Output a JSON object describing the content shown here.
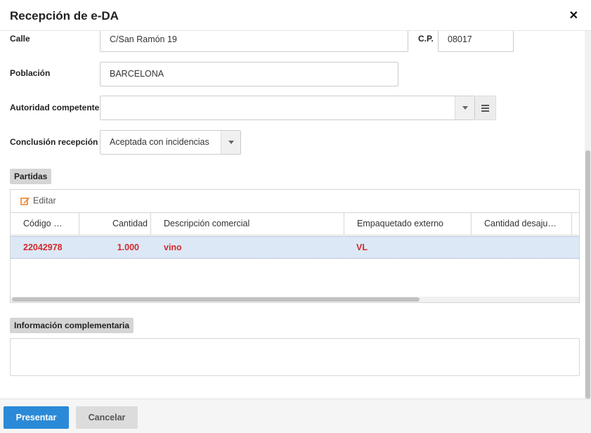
{
  "dialog": {
    "title": "Recepción de e-DA",
    "close_icon": "close-icon"
  },
  "form": {
    "calle": {
      "label": "Calle",
      "value": "C/San Ramón 19"
    },
    "cp": {
      "label": "C.P.",
      "value": "08017"
    },
    "poblacion": {
      "label": "Población",
      "value": "BARCELONA"
    },
    "autoridad": {
      "label": "Autoridad competente",
      "value": ""
    },
    "conclusion": {
      "label": "Conclusión recepción",
      "value": "Aceptada con incidencias"
    }
  },
  "partidas": {
    "section_label": "Partidas",
    "toolbar": {
      "edit_label": "Editar",
      "edit_icon": "pencil-icon"
    },
    "columns": [
      "Código NC",
      "Cantidad",
      "Descripción comercial",
      "Empaquetado externo",
      "Cantidad desajus…"
    ],
    "rows": [
      {
        "codigo": "22042978",
        "cantidad": "1.000",
        "descripcion": "vino",
        "empaquetado": "VL",
        "desajuste": ""
      }
    ]
  },
  "info_complementaria": {
    "section_label": "Información complementaria",
    "value": ""
  },
  "footer": {
    "submit_label": "Presentar",
    "cancel_label": "Cancelar"
  },
  "colors": {
    "primary": "#2a8ad8",
    "row_highlight": "#dde8f6",
    "row_text": "#d12b2b",
    "edit_icon": "#f07b1e"
  }
}
